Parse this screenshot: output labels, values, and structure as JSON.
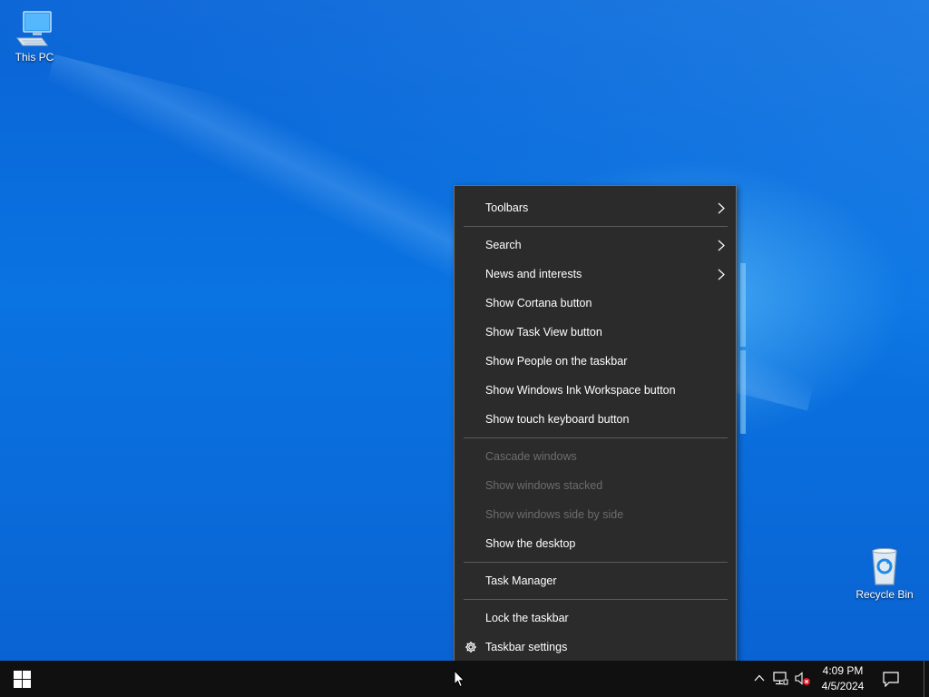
{
  "desktop": {
    "icons": [
      {
        "label": "This PC",
        "icon": "this-pc-icon"
      },
      {
        "label": "Recycle Bin",
        "icon": "recycle-bin-icon"
      }
    ]
  },
  "context_menu": {
    "items": [
      {
        "id": "toolbars",
        "label": "Toolbars",
        "submenu": true,
        "enabled": true
      },
      {
        "id": "search",
        "label": "Search",
        "submenu": true,
        "enabled": true
      },
      {
        "id": "news",
        "label": "News and interests",
        "submenu": true,
        "enabled": true
      },
      {
        "id": "cortana",
        "label": "Show Cortana button",
        "enabled": true
      },
      {
        "id": "taskview",
        "label": "Show Task View button",
        "enabled": true
      },
      {
        "id": "people",
        "label": "Show People on the taskbar",
        "enabled": true
      },
      {
        "id": "ink",
        "label": "Show Windows Ink Workspace button",
        "enabled": true
      },
      {
        "id": "touchkb",
        "label": "Show touch keyboard button",
        "enabled": true
      },
      {
        "id": "cascade",
        "label": "Cascade windows",
        "enabled": false
      },
      {
        "id": "stacked",
        "label": "Show windows stacked",
        "enabled": false
      },
      {
        "id": "sidebyside",
        "label": "Show windows side by side",
        "enabled": false
      },
      {
        "id": "showdesktop",
        "label": "Show the desktop",
        "enabled": true
      },
      {
        "id": "taskmgr",
        "label": "Task Manager",
        "enabled": true
      },
      {
        "id": "lock",
        "label": "Lock the taskbar",
        "enabled": true
      },
      {
        "id": "settings",
        "label": "Taskbar settings",
        "enabled": true,
        "icon": "gear-icon"
      }
    ]
  },
  "taskbar": {
    "clock": {
      "time": "4:09 PM",
      "date": "4/5/2024"
    },
    "tray_icons": [
      "chevron-up-icon",
      "network-icon",
      "volume-muted-icon"
    ],
    "notification_icon": "action-center-icon"
  },
  "colors": {
    "menu_bg": "#2b2b2b",
    "menu_border": "#6f6f6f",
    "disabled_text": "#6d6d6d",
    "taskbar_bg": "#101010"
  }
}
